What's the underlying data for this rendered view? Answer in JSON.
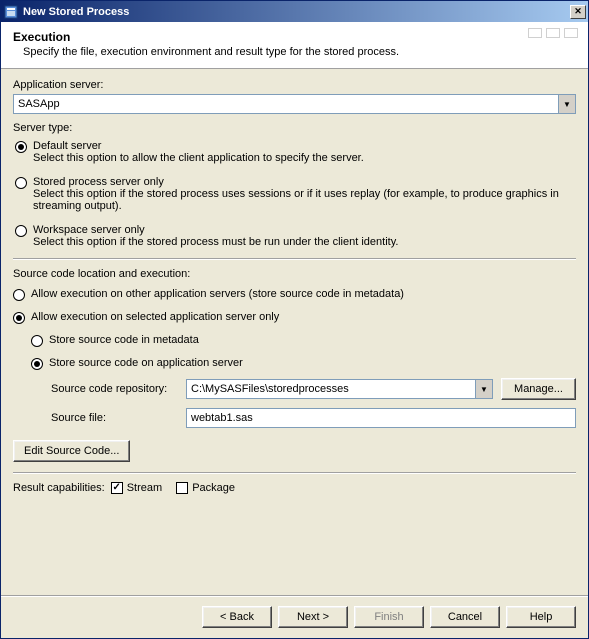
{
  "titlebar": {
    "title": "New Stored Process"
  },
  "header": {
    "title": "Execution",
    "description": "Specify the file, execution environment and result type for the stored process."
  },
  "appserver": {
    "label": "Application server:",
    "value": "SASApp"
  },
  "servertype": {
    "label": "Server type:",
    "options": {
      "default": {
        "title": "Default server",
        "desc": "Select this option to allow the client application to specify the server."
      },
      "stored": {
        "title": "Stored process server only",
        "desc": "Select this option if the stored process uses sessions or if it uses replay (for example, to produce graphics in streaming output)."
      },
      "workspace": {
        "title": "Workspace server only",
        "desc": "Select this option if the stored process must be run under the client identity."
      }
    }
  },
  "sourceloc": {
    "label": "Source code location and execution:",
    "otherServers": "Allow execution on other application servers (store source code in metadata)",
    "selectedOnly": "Allow execution on selected application server only",
    "storeMeta": "Store source code in metadata",
    "storeApp": "Store source code on application server",
    "repoLabel": "Source code repository:",
    "repoValue": "C:\\MySASFiles\\storedprocesses",
    "manage": "Manage...",
    "fileLabel": "Source file:",
    "fileValue": "webtab1.sas",
    "editBtn": "Edit Source Code..."
  },
  "results": {
    "label": "Result capabilities:",
    "stream": "Stream",
    "package": "Package"
  },
  "buttons": {
    "back": "< Back",
    "next": "Next >",
    "finish": "Finish",
    "cancel": "Cancel",
    "help": "Help"
  }
}
